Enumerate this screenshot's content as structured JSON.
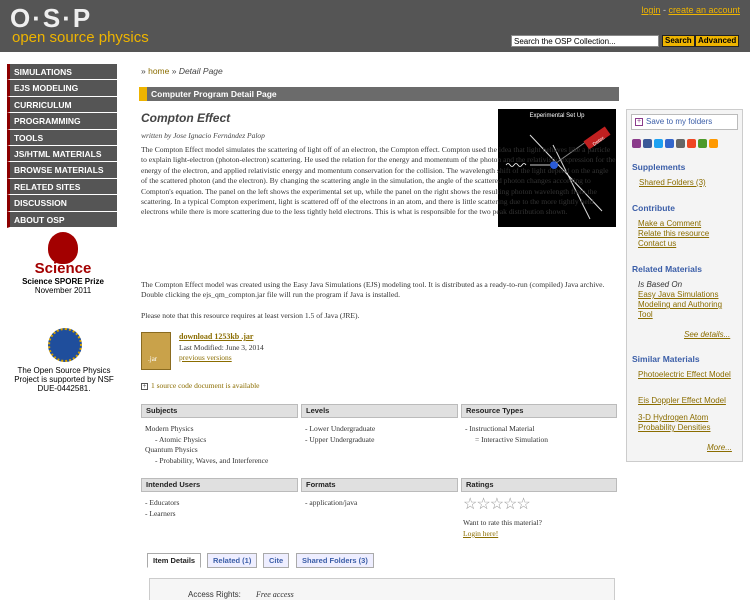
{
  "header": {
    "logo_text": "O·S·P",
    "logo_sub": "open source physics",
    "login": "login",
    "separator": " - ",
    "create_account": "create an account",
    "search_placeholder": "Search the OSP Collection...",
    "search_button": "Search",
    "advanced_button": "Advanced"
  },
  "nav": {
    "items": [
      "SIMULATIONS",
      "EJS MODELING",
      "CURRICULUM",
      "PROGRAMMING",
      "TOOLS",
      "JS/HTML MATERIALS",
      "BROWSE MATERIALS",
      "RELATED SITES",
      "DISCUSSION",
      "ABOUT OSP"
    ]
  },
  "left_extras": {
    "science_word": "Science",
    "prize_title": "Science SPORE Prize",
    "prize_date": "November 2011",
    "nsf_text": "The Open Source Physics Project is supported by NSF DUE-0442581."
  },
  "breadcrumb": {
    "home": "home",
    "sep": " » ",
    "current": "Detail Page"
  },
  "page_heading": "Computer Program Detail Page",
  "resource": {
    "title": "Compton Effect",
    "author": "written by Jose Ignacio Fernández Palop",
    "abstract": "The Compton Effect model simulates the scattering of light off of an electron, the Compton effect. Compton used the idea that light behaves like a particle to explain light-electron (photon-electron) scattering. He used the relation for the energy and momentum of the photon and the relativistic expression for the energy of the electron, and applied relativistic energy and momentum conservation for the collision. The wavelength shift of the light depend on the angle of the scattered photon (and the electron). By changing the scattering angle in the simulation, the angle of the scattered photon changes according to Compton's equation. The panel on the left shows the experimental set up, while the panel on the right shows the resulting photon wavelength from the scattering. In a typical Compton experiment, light is scattered off of the electrons in an atom, and there is little scattering due to the more tightly held electrons while there is more scattering due to the less tightly held electrons. This is what is responsible for the two peak distribution shown.",
    "para2": "The Compton Effect model was created using the Easy Java Simulations (EJS) modeling tool. It is distributed as a ready-to-run (compiled) Java archive. Double clicking the ejs_qm_compton.jar file will run the program if Java is installed.",
    "para3": "Please note that this resource requires at least version 1.5 of Java (JRE).",
    "image_caption": "Experimental Set Up",
    "image_label": "Detec",
    "jar_label": ".jar",
    "download_label": "download 1253kb .jar",
    "last_modified": "Last Modified: June 3, 2014",
    "previous_versions": "previous versions",
    "source_plus": "+",
    "source_doc": "1 source code document is available"
  },
  "info": {
    "subjects_head": "Subjects",
    "subjects": [
      "Modern Physics",
      "- Atomic Physics",
      "Quantum Physics",
      "- Probability, Waves, and Interference"
    ],
    "levels_head": "Levels",
    "levels": [
      "- Lower Undergraduate",
      "- Upper Undergraduate"
    ],
    "types_head": "Resource Types",
    "types": [
      "- Instructional Material",
      "= Interactive Simulation"
    ],
    "users_head": "Intended Users",
    "users": [
      "- Educators",
      "- Learners"
    ],
    "formats_head": "Formats",
    "formats": [
      "- application/java"
    ],
    "ratings_head": "Ratings",
    "stars": "☆☆☆☆☆",
    "rate_question": "Want to rate this material?",
    "login_rate": "Login here!"
  },
  "tabs": [
    "Item Details",
    "Related (1)",
    "Cite",
    "Shared Folders (3)"
  ],
  "details": {
    "access_label": "Access Rights:",
    "access_value": "Free access"
  },
  "rightbar": {
    "save_plus": "+",
    "save": "Save to my folders",
    "supplements_head": "Supplements",
    "shared_folders": "Shared Folders (3)",
    "contribute_head": "Contribute",
    "make_comment": "Make a Comment",
    "relate": "Relate this resource",
    "contact": "Contact us",
    "related_head": "Related Materials",
    "is_based_on": "Is Based On",
    "based_link": "Easy Java Simulations Modeling and Authoring Tool",
    "see_details": "See details...",
    "similar_head": "Similar Materials",
    "similar": [
      "Photoelectric Effect Model",
      "Eis Doppler Effect Model",
      "3-D Hydrogen Atom Probability Densities"
    ],
    "more": "More..."
  },
  "colors": {
    "header_bg": "#555555",
    "accent": "#eeb400",
    "link": "#8b6d00",
    "blue_head": "#3b5ea8"
  }
}
